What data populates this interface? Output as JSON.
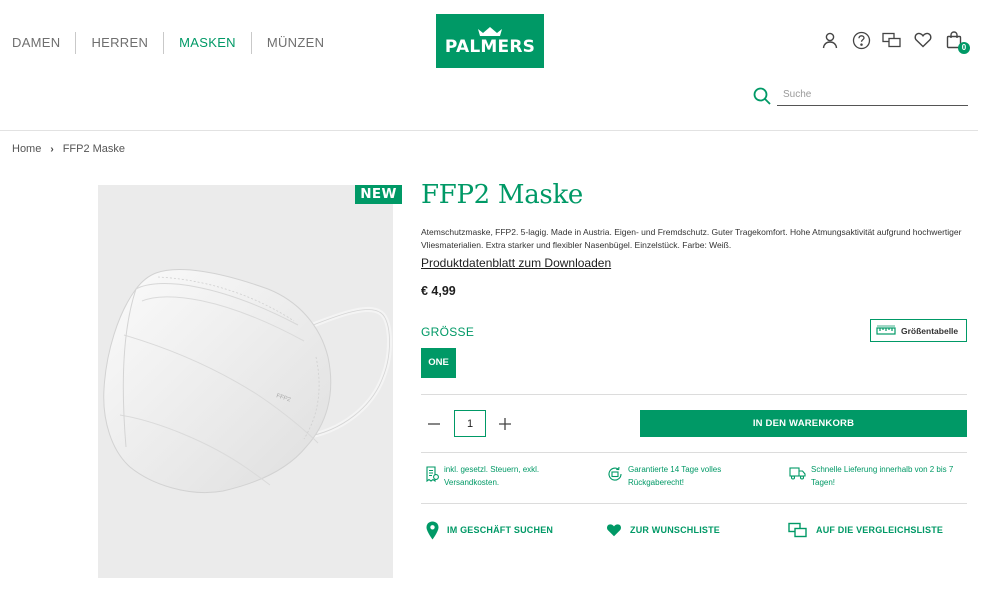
{
  "nav": {
    "items": [
      "DAMEN",
      "HERREN",
      "MASKEN",
      "MÜNZEN"
    ],
    "active": "MASKEN"
  },
  "logo": {
    "text": "PALMERS"
  },
  "header": {
    "icons": [
      "user-icon",
      "help-icon",
      "compare-icon",
      "heart-icon",
      "bag-icon"
    ],
    "cart_count": "0"
  },
  "search": {
    "placeholder": "Suche",
    "value": ""
  },
  "breadcrumb": {
    "items": [
      "Home",
      "FFP2 Maske"
    ]
  },
  "product": {
    "badge": "NEW",
    "title": "FFP2 Maske",
    "description": "Atemschutzmaske, FFP2. 5-lagig. Made in Austria. Eigen- und Fremdschutz. Guter Tragekomfort. Hohe Atmungsaktivität aufgrund hochwertiger Vliesmaterialien. Extra starker und flexibler Nasenbügel. Einzelstück. Farbe: Weiß.",
    "datasheet_link": "Produktdatenblatt zum Downloaden",
    "price": "€ 4,99",
    "mask_print": "FFP2"
  },
  "size": {
    "label": "GRÖSSE",
    "size_table": "Größentabelle",
    "options": [
      "ONE"
    ],
    "selected": "ONE"
  },
  "purchase": {
    "quantity": "1",
    "add_to_cart": "IN DEN WARENKORB"
  },
  "perks": [
    {
      "icon": "receipt-icon",
      "text": "inkl. gesetzl. Steuern, exkl. Versandkosten."
    },
    {
      "icon": "return-icon",
      "text": "Garantierte 14 Tage volles Rückgaberecht!"
    },
    {
      "icon": "truck-icon",
      "text": "Schnelle Lieferung innerhalb von 2 bis 7 Tagen!"
    }
  ],
  "actions": [
    {
      "icon": "location-pin-icon",
      "label": "IM GESCHÄFT SUCHEN"
    },
    {
      "icon": "heart-icon",
      "label": "ZUR WUNSCHLISTE"
    },
    {
      "icon": "compare-icon",
      "label": "AUF DIE VERGLEICHSLISTE"
    }
  ],
  "colors": {
    "brand": "#009966",
    "image_bg": "#ebebeb"
  }
}
